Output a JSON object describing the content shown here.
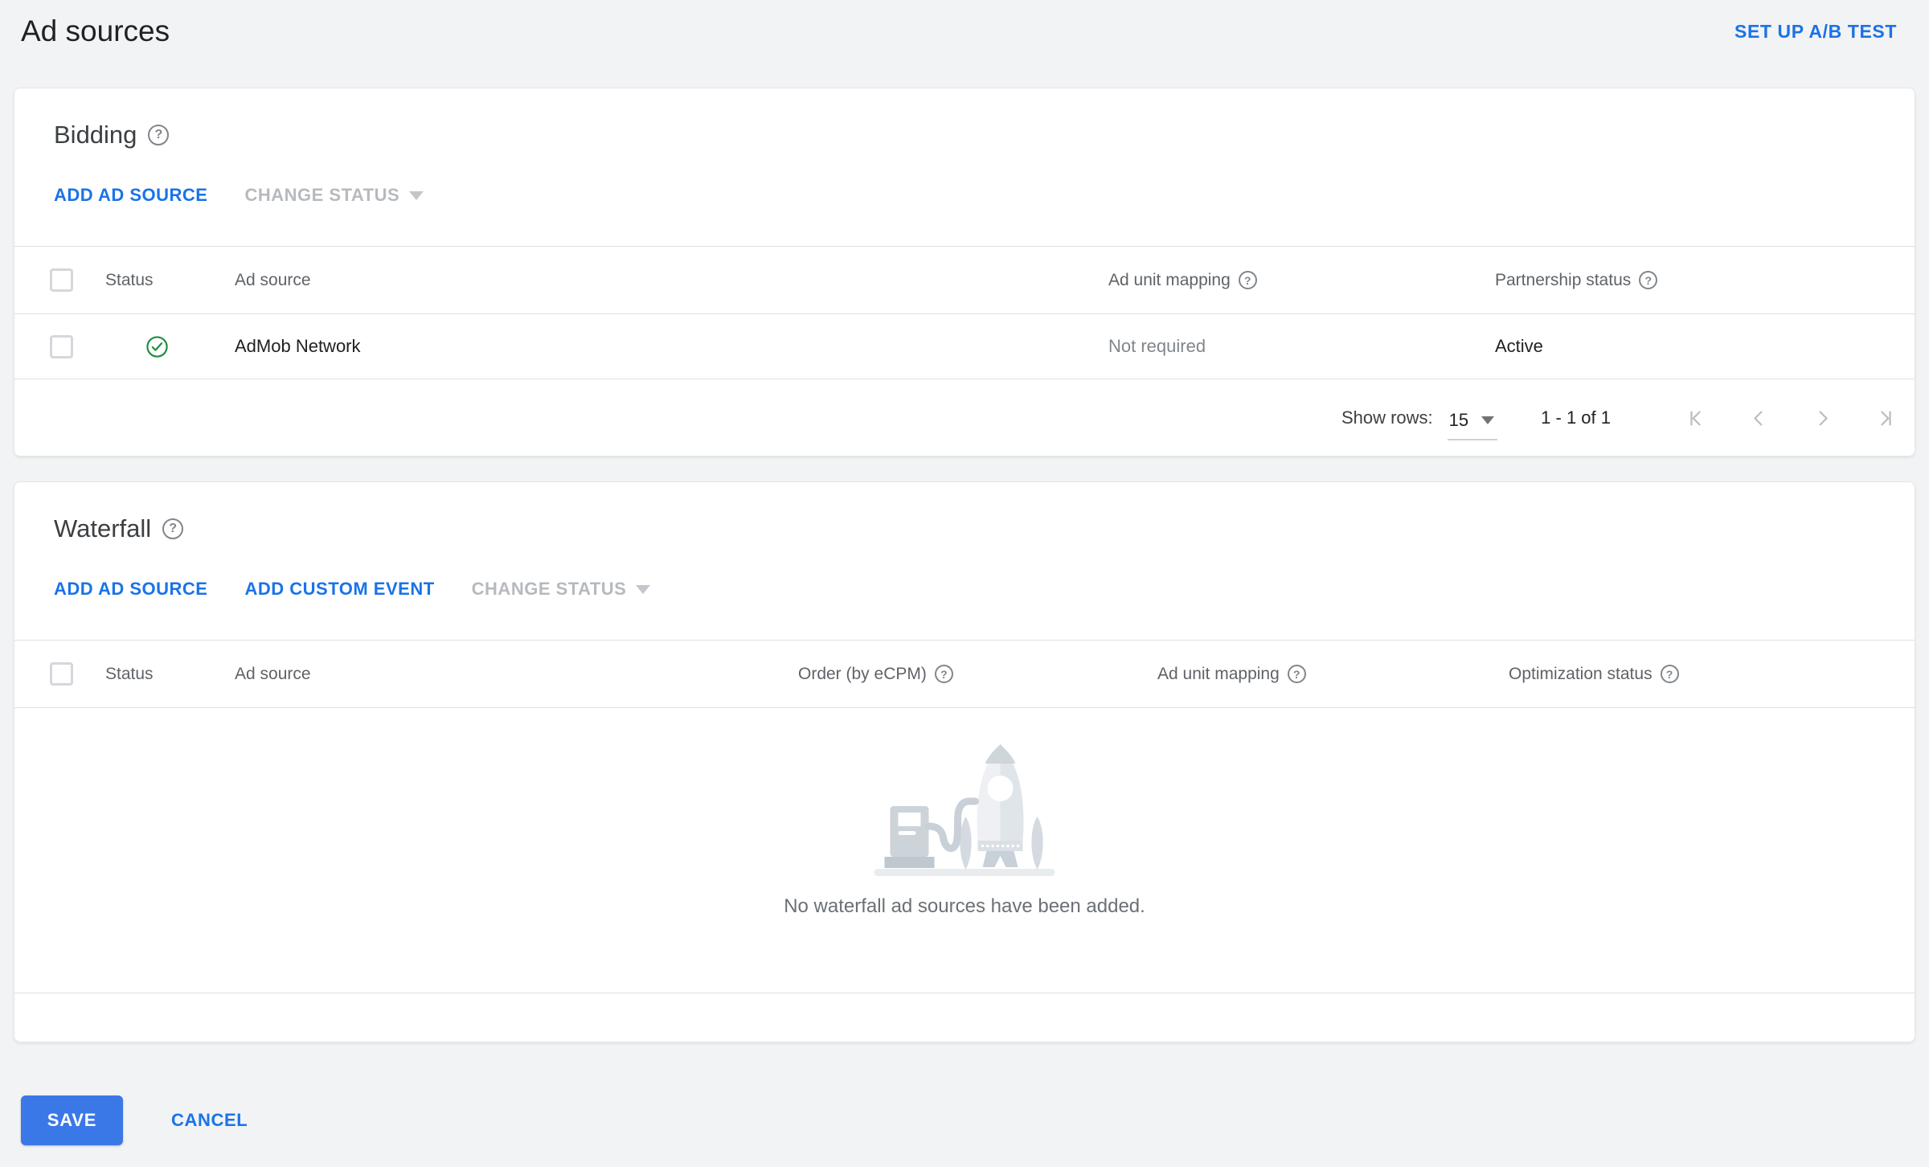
{
  "header": {
    "title": "Ad sources",
    "ab_test_link": "SET UP A/B TEST"
  },
  "icons": {
    "help_glyph": "?"
  },
  "colors": {
    "page_background": "#f1f3f4",
    "card_background": "#ffffff",
    "link_blue": "#1a73e8",
    "save_button_blue": "#3b78e7",
    "status_active_green": "#1e8e3e",
    "disabled_gray": "#b6babe",
    "header_text_gray": "#5f6368",
    "divider_gray": "#e0e0e0"
  },
  "bidding": {
    "title": "Bidding",
    "actions": {
      "add_ad_source": "ADD AD SOURCE",
      "change_status": "CHANGE STATUS"
    },
    "columns": {
      "status": "Status",
      "ad_source": "Ad source",
      "ad_unit_mapping": "Ad unit mapping",
      "partnership_status": "Partnership status"
    },
    "row": {
      "status_icon": "check-circle",
      "ad_source": "AdMob Network",
      "ad_unit_mapping": "Not required",
      "partnership_status": "Active"
    },
    "pagination": {
      "show_rows_label": "Show rows:",
      "rows_per_page": "15",
      "range": "1 - 1 of 1"
    }
  },
  "waterfall": {
    "title": "Waterfall",
    "actions": {
      "add_ad_source": "ADD AD SOURCE",
      "add_custom_event": "ADD CUSTOM EVENT",
      "change_status": "CHANGE STATUS"
    },
    "columns": {
      "status": "Status",
      "ad_source": "Ad source",
      "order": "Order (by eCPM)",
      "ad_unit_mapping": "Ad unit mapping",
      "optimization_status": "Optimization status"
    },
    "empty_message": "No waterfall ad sources have been added."
  },
  "footer": {
    "save": "SAVE",
    "cancel": "CANCEL"
  }
}
